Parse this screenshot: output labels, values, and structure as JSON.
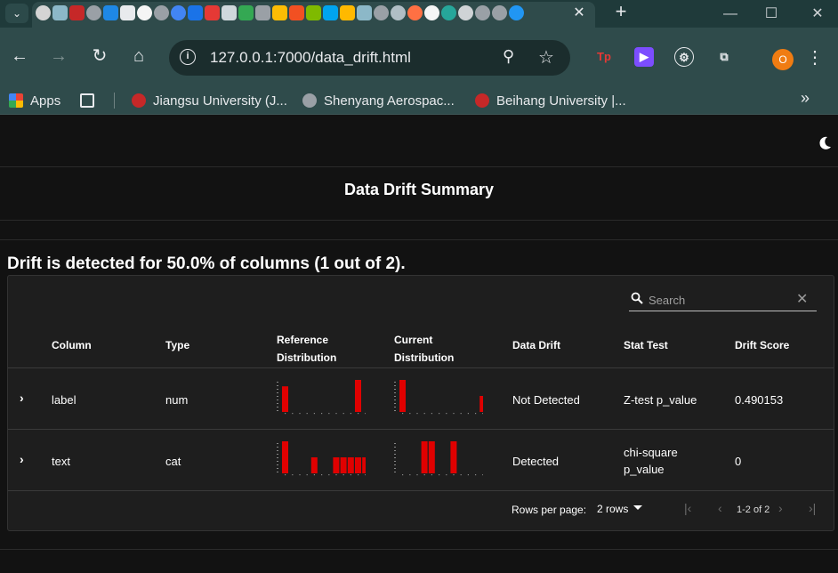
{
  "browser": {
    "tab_close": "✕",
    "new_tab": "+",
    "url": "127.0.0.1:7000/data_drift.html",
    "bookmarks": [
      {
        "label": "Apps"
      },
      {
        "label": "Jiangsu University (J..."
      },
      {
        "label": "Shenyang Aerospac..."
      },
      {
        "label": "Beihang University |..."
      }
    ],
    "profile_initial": "O"
  },
  "page": {
    "title": "Data Drift Summary",
    "drift_message": "Drift is detected for 50.0% of columns (1 out of 2).",
    "search_placeholder": "Search",
    "headers": {
      "column": "Column",
      "type": "Type",
      "ref_dist_1": "Reference",
      "ref_dist_2": "Distribution",
      "cur_dist_1": "Current",
      "cur_dist_2": "Distribution",
      "data_drift": "Data Drift",
      "stat_test": "Stat Test",
      "drift_score": "Drift Score"
    },
    "rows": [
      {
        "column": "label",
        "type": "num",
        "data_drift": "Not Detected",
        "stat_test_1": "Z-test p_value",
        "stat_test_2": "",
        "drift_score": "0.490153",
        "ref_dist": [
          0.8,
          0,
          0,
          0,
          0,
          0,
          0,
          0,
          0,
          0,
          1.0,
          0
        ],
        "cur_dist": [
          1.0,
          0,
          0,
          0,
          0,
          0,
          0,
          0,
          0,
          0,
          0,
          0.5
        ]
      },
      {
        "column": "text",
        "type": "cat",
        "data_drift": "Detected",
        "stat_test_1": "chi-square",
        "stat_test_2": "p_value",
        "drift_score": "0",
        "ref_dist": [
          1.0,
          0,
          0,
          0,
          0.5,
          0,
          0,
          0.5,
          0.5,
          0.5,
          0.5,
          0.5
        ],
        "cur_dist": [
          0,
          0,
          0,
          1.0,
          1.0,
          0,
          0,
          1.0,
          0,
          0,
          0,
          0
        ]
      }
    ],
    "footer": {
      "rows_per_page_label": "Rows per page:",
      "rows_per_page_value": "2 rows",
      "range": "1-2 of 2"
    }
  },
  "colors": {
    "bar": "#e00000",
    "background": "#121212",
    "card": "#1e1e1e"
  }
}
